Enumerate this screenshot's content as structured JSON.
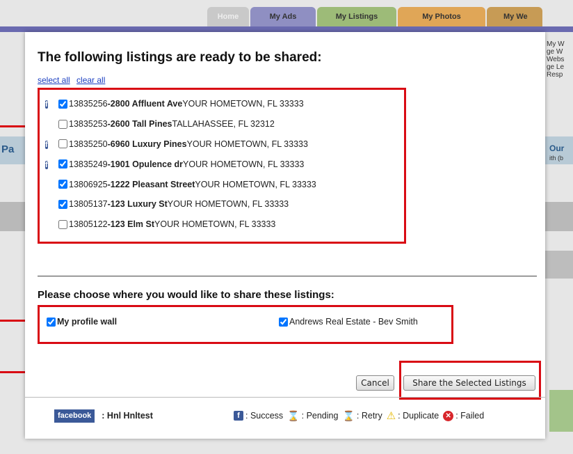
{
  "background": {
    "nav_tabs": [
      "Home",
      "My Ads",
      "My Listings",
      "My Photos",
      "My We"
    ],
    "left_text": "Pa",
    "right_title": "Our",
    "right_sub": "ith (b",
    "right_text": "My W\nge W\nWebs\nge Le\nResp"
  },
  "dialog": {
    "title": "The following listings are ready to be shared:",
    "select_all": "select all",
    "clear_all": "clear all",
    "listings": [
      {
        "facebook": true,
        "checked": true,
        "mls": "13835256",
        "street": "2800 Affluent Ave",
        "city": "YOUR HOMETOWN, FL 33333"
      },
      {
        "facebook": false,
        "checked": false,
        "mls": "13835253",
        "street": "2600 Tall Pines",
        "city": "TALLAHASSEE, FL 32312"
      },
      {
        "facebook": true,
        "checked": false,
        "mls": "13835250",
        "street": "6960 Luxury Pines",
        "city": "YOUR HOMETOWN, FL 33333"
      },
      {
        "facebook": true,
        "checked": true,
        "mls": "13835249",
        "street": "1901 Opulence dr",
        "city": "YOUR HOMETOWN, FL 33333"
      },
      {
        "facebook": false,
        "checked": true,
        "mls": "13806925",
        "street": "1222 Pleasant Street",
        "city": "YOUR HOMETOWN, FL 33333"
      },
      {
        "facebook": false,
        "checked": true,
        "mls": "13805137",
        "street": "123 Luxury St",
        "city": "YOUR HOMETOWN, FL 33333"
      },
      {
        "facebook": false,
        "checked": false,
        "mls": "13805122",
        "street": "123 Elm St",
        "city": "YOUR HOMETOWN, FL 33333"
      }
    ],
    "separator": " - ",
    "share_prompt": "Please choose where you would like to share these listings:",
    "targets": [
      {
        "label": "My profile wall",
        "checked": true
      },
      {
        "label": "Andrews Real Estate - Bev Smith",
        "checked": true
      }
    ],
    "cancel_label": "Cancel",
    "share_label": "Share the Selected Listings",
    "footer": {
      "facebook_logo": "facebook",
      "user": ": Hnl Hnltest",
      "legend": [
        {
          "icon": "facebook-success-icon",
          "glyph": "f",
          "text": ": Success"
        },
        {
          "icon": "hourglass-pending-icon",
          "glyph": "⌛",
          "text": ": Pending"
        },
        {
          "icon": "retry-icon",
          "glyph": "⌛",
          "text": ": Retry"
        },
        {
          "icon": "warning-duplicate-icon",
          "glyph": "⚠",
          "text": ": Duplicate"
        },
        {
          "icon": "failed-x-icon",
          "glyph": "✕",
          "text": ": Failed"
        }
      ]
    }
  },
  "colors": {
    "highlight_red": "#d90b14",
    "facebook_blue": "#3b5998",
    "link_blue": "#1a3ec0"
  }
}
